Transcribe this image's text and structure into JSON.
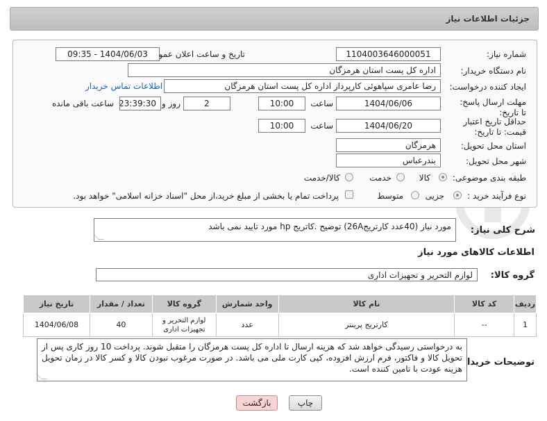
{
  "header": {
    "title": "جزئیات اطلاعات نیاز"
  },
  "form": {
    "need_number_label": "شماره نیاز:",
    "need_number": "1104003646000051",
    "announce_label": "تاریخ و ساعت اعلان عمومی:",
    "announce_value": "1404/06/03 - 09:35",
    "buyer_org_label": "نام دستگاه خریدار:",
    "buyer_org": "اداره کل پست استان هرمزگان",
    "creator_label": "ایجاد کننده درخواست:",
    "creator": "رضا عامری سپاهوئی کارپرداز اداره کل پست استان هرمزگان",
    "contact_link": "اطلاعات تماس خریدار",
    "reply_deadline_label": "مهلت ارسال پاسخ: تا تاریخ:",
    "reply_date": "1404/06/06",
    "time_label": "ساعت",
    "reply_time": "10:00",
    "days_count": "2",
    "days_label": "روز و",
    "remaining_time": "23:39:30",
    "remaining_label": "ساعت باقی مانده",
    "price_deadline_label": "حداقل تاریخ اعتبار قیمت: تا تاریخ:",
    "price_date": "1404/06/20",
    "price_time": "10:00",
    "province_label": "استان محل تحویل:",
    "province": "هرمزگان",
    "city_label": "شهر محل تحویل:",
    "city": "بندرعباس",
    "category_label": "طبقه بندی موضوعی:",
    "category_options": [
      "کالا",
      "خدمت",
      "کالا/خدمت"
    ],
    "process_label": "نوع فرآیند خرید :",
    "process_options": [
      "جزیی",
      "متوسط"
    ],
    "payment_note": "پرداخت تمام یا بخشی از مبلغ خرید،از محل \"اسناد خزانه اسلامی\" خواهد بود."
  },
  "summary": {
    "label": "شرح کلی نیاز:",
    "text": "مورد نیاز  (40عدد کارتریج26A)    توضیح .کاتریج hp  مورد تایید نمی باشد"
  },
  "goods": {
    "section_title": "اطلاعات کالاهای مورد نیاز",
    "group_label": "گروه کالا:",
    "group_value": "لوازم التحریر و تجهیزات اداری",
    "columns": [
      "ردیف",
      "کد کالا",
      "نام کالا",
      "واحد شمارش",
      "گروه کالا",
      "تعداد / مقدار",
      "تاریخ نیاز"
    ],
    "rows": [
      [
        "1",
        "--",
        "کارتریج پرینتر",
        "عدد",
        "لوازم التحریر و تجهیزات اداری",
        "40",
        "1404/06/08"
      ]
    ]
  },
  "buyer_notes": {
    "label": "توضیحات خریدار:",
    "text": "به درخواستی  رسیدگی خواهد شد که هزینه ارسال تا اداره کل پست هرمزگان را متقبل شوند. پرداخت 10 روز کاری پس از تحویل کالا و فاکتور، فرم ارزش افزوده، کپی کارت ملی می باشد. در صورت مرغوب نبودن کالا و کسر کالا در زمان تحویل هزینه عودت با تامین کننده است."
  },
  "buttons": {
    "print": "چاپ",
    "back": "بازگشت"
  },
  "watermark": {
    "brand": "AriaTender.neT"
  }
}
